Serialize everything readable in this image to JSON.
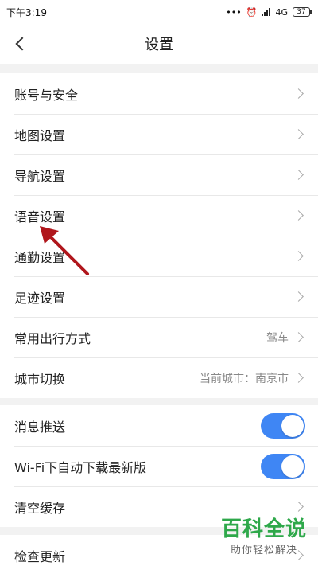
{
  "status_bar": {
    "time": "下午3:19",
    "dots": "•••",
    "alarm_icon": "alarm-icon",
    "network": "4G",
    "network_sub": "ᵍ",
    "battery": "37"
  },
  "header": {
    "title": "设置",
    "back_icon": "chevron-left-icon"
  },
  "group1": {
    "items": [
      {
        "label": "账号与安全",
        "value": ""
      },
      {
        "label": "地图设置",
        "value": ""
      },
      {
        "label": "导航设置",
        "value": ""
      },
      {
        "label": "语音设置",
        "value": ""
      },
      {
        "label": "通勤设置",
        "value": ""
      },
      {
        "label": "足迹设置",
        "value": ""
      },
      {
        "label": "常用出行方式",
        "value": "驾车"
      },
      {
        "label": "城市切换",
        "value": "当前城市：南京市"
      }
    ]
  },
  "group2": {
    "items": [
      {
        "label": "消息推送",
        "toggle": true
      },
      {
        "label": "Wi-Fi下自动下载最新版",
        "toggle": true
      },
      {
        "label": "清空缓存",
        "value": ""
      }
    ]
  },
  "group3": {
    "items": [
      {
        "label": "检查更新",
        "value": ""
      }
    ]
  },
  "watermark": {
    "title": "百科全说",
    "subtitle": "助你轻松解决"
  },
  "colors": {
    "accent": "#3f86f4",
    "annotation_arrow": "#b0161c",
    "watermark": "#2ea84a"
  }
}
